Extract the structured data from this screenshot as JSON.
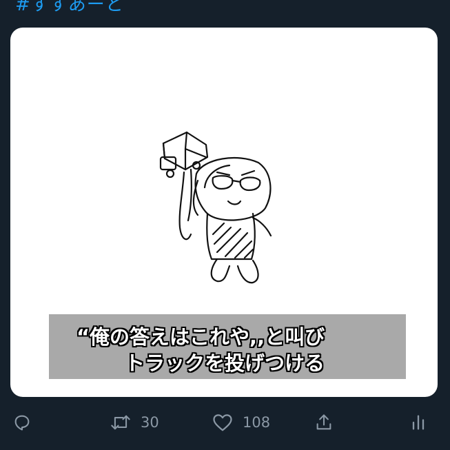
{
  "tweet": {
    "hashtag": "#すすあーと"
  },
  "media": {
    "caption_line1": "“俺の答えはこれや,,と叫び",
    "caption_line2": "トラックを投げつける"
  },
  "actions": {
    "reply_icon": "reply-icon",
    "retweet_icon": "retweet-icon",
    "retweet_count": "30",
    "like_icon": "heart-icon",
    "like_count": "108",
    "share_icon": "share-icon",
    "analytics_icon": "analytics-icon"
  },
  "colors": {
    "background": "#15202b",
    "accent": "#1d9bf0",
    "icon_gray": "#8b98a5"
  }
}
